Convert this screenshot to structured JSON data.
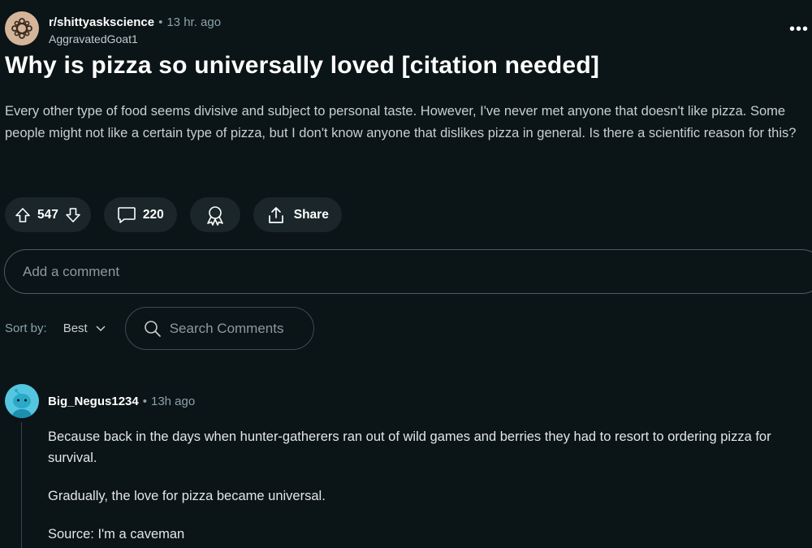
{
  "post": {
    "subreddit": "r/shittyaskscience",
    "time": "13 hr. ago",
    "author": "AggravatedGoat1",
    "more": "•••",
    "title": "Why is pizza so universally loved [citation needed]",
    "body": "Every other type of food seems divisive and subject to personal taste. However, I've never met anyone that doesn't like pizza. Some people might not like a certain type of pizza, but I don't know anyone that dislikes pizza in general. Is there a scientific reason for this?"
  },
  "actions": {
    "votes": "547",
    "comments": "220",
    "share_label": "Share"
  },
  "comment_box": {
    "placeholder": "Add a comment"
  },
  "sort": {
    "label": "Sort by:",
    "selected": "Best"
  },
  "search": {
    "placeholder": "Search Comments"
  },
  "comment": {
    "author": "Big_Negus1234",
    "time": "13h ago",
    "paragraphs": [
      "Because back in the days when hunter-gatherers ran out of wild games and berries they had to resort to ordering pizza for survival.",
      "Gradually, the love for pizza became universal.",
      "Source: I'm a caveman"
    ]
  },
  "colors": {
    "background": "#0b1416",
    "pill": "#1a2629",
    "subreddit_avatar": "#d4b59a",
    "user_avatar": "#54c6e0"
  },
  "icons": {
    "subreddit_avatar": "subreddit-avatar-icon",
    "more": "more-options-icon",
    "upvote": "upvote-arrow-icon",
    "downvote": "downvote-arrow-icon",
    "comment": "comment-bubble-icon",
    "award": "award-icon",
    "share": "share-icon",
    "chevron": "chevron-down-icon",
    "search": "search-icon",
    "user_avatar": "snoo-avatar-icon"
  }
}
